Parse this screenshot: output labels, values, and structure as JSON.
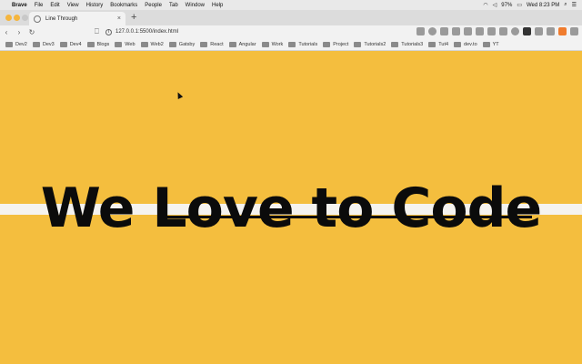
{
  "menubar": {
    "app_name": "Brave",
    "items": [
      "File",
      "Edit",
      "View",
      "History",
      "Bookmarks",
      "People",
      "Tab",
      "Window",
      "Help"
    ],
    "battery": "97%",
    "clock": "Wed 8:23 PM"
  },
  "tab": {
    "title": "Line Through",
    "close_glyph": "×",
    "new_tab_glyph": "+"
  },
  "toolbar": {
    "back_glyph": "‹",
    "forward_glyph": "›",
    "reload_glyph": "↻",
    "url": "127.0.0.1:5500/index.html"
  },
  "bookmarks": [
    "Dev2",
    "Dev3",
    "Dev4",
    "Blogs",
    "Web",
    "Web2",
    "Gatsby",
    "React",
    "Angular",
    "Work",
    "Tutorials",
    "Project",
    "Tutorials2",
    "Tutorials3",
    "Tut4",
    "dev.to",
    "YT"
  ],
  "page": {
    "headline": "We Love to Code",
    "background_color": "#f4be3e",
    "text_color": "#0b0b0b"
  }
}
